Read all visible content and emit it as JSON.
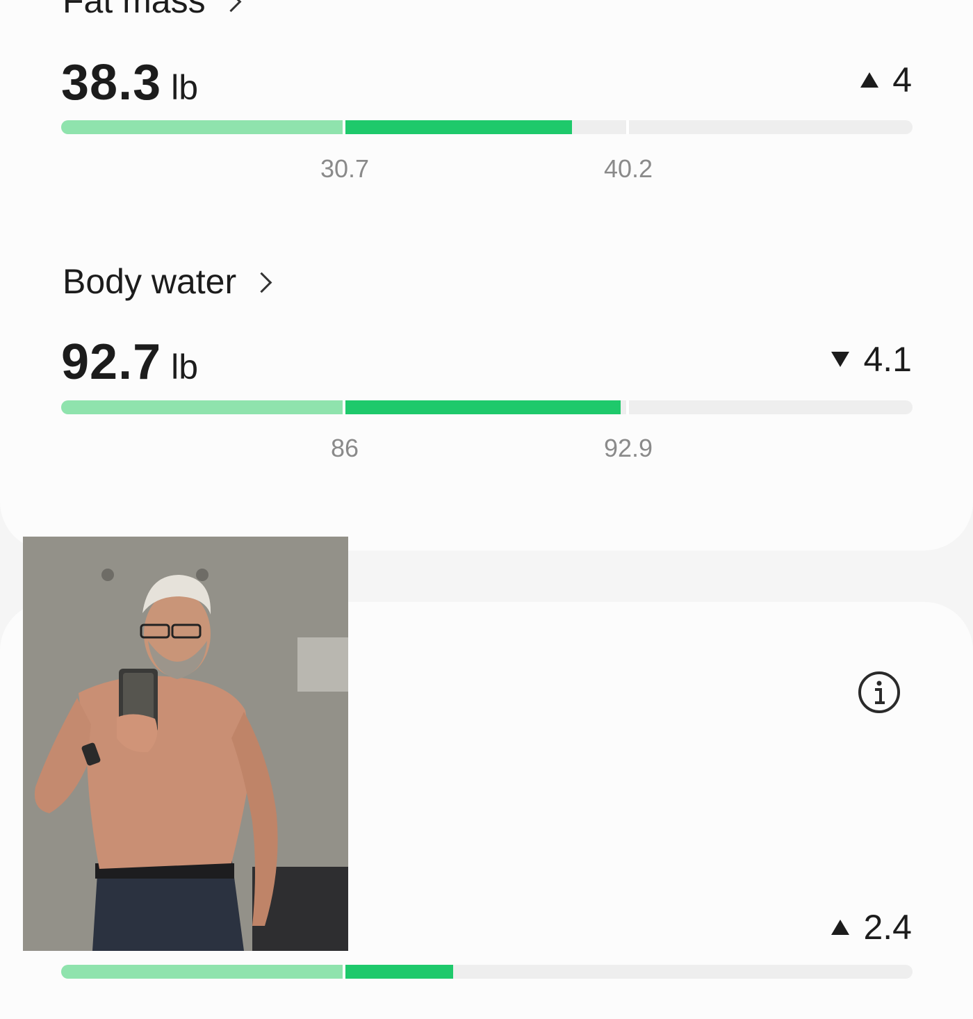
{
  "fat_mass": {
    "title": "Fat mass",
    "value": "38.3",
    "unit": "lb",
    "change_direction": "up",
    "change": "4",
    "range_low": "30.7",
    "range_high": "40.2",
    "level_fraction": 0.6
  },
  "body_water": {
    "title": "Body water",
    "value": "92.7",
    "unit": "lb",
    "change_direction": "down",
    "change": "4.1",
    "range_low": "86",
    "range_high": "92.9",
    "level_fraction": 0.657
  },
  "next_metric": {
    "change_direction": "up",
    "change": "2.4",
    "level_fraction": 0.46
  },
  "photo": {
    "description_icon": "mirror-selfie-photo"
  },
  "icons": {
    "info": "info-icon",
    "chevron": "chevron-right-icon"
  },
  "colors": {
    "low_segment": "#8fe3ad",
    "normal_segment": "#1ec96b",
    "track": "#eeeeee",
    "text": "#1c1c1c",
    "tick_text": "#8a8a8a"
  }
}
